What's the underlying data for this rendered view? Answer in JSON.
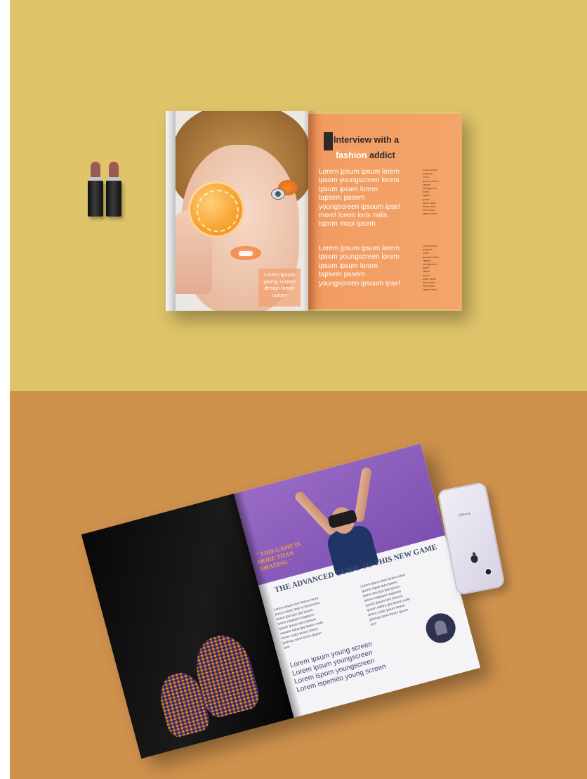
{
  "top_magazine": {
    "headline": {
      "part1": "Interview with a",
      "accent": "fashion",
      "part2": "addict"
    },
    "body_paragraph_1": [
      "Lorem jpsum ipsum lorem",
      "ipsom youngscreen lorem",
      "ipsum ipsum lorem",
      "tapsem pasem",
      "youngscreen ipsoum ipsel",
      "morel lorem loris riolis",
      "ispom mopi ipsem"
    ],
    "body_paragraph_2": [
      "Lorem jpsum ipsum lorem",
      "ipsom youngscreen lorem",
      "ipsum ipsum lorem",
      "tapsem pasem",
      "youngscreen ipsoum ipsel"
    ],
    "side_column_1": [
      "Lorem ipsum",
      "ipsgrona",
      "lorem",
      "ipsonon lorem",
      "ragram",
      "youngscreen",
      "lorum",
      "ragem",
      "ipsom",
      "mane rapse",
      "ipsum uma",
      "rem fleurie",
      "ragem lorem"
    ],
    "side_column_2": [
      "Lorem ipsum",
      "ipsgrona",
      "lorem",
      "ipsonon lorem",
      "ragram",
      "youngscreen",
      "lorum",
      "ragem",
      "ipsom",
      "mane rapse",
      "ipsum uma",
      "rem fleurie",
      "ragem lorem"
    ],
    "photo_caption": [
      "Lorem ipsum",
      "young screen",
      "design lomer",
      "ispom"
    ]
  },
  "bottom_magazine": {
    "pull_quote": [
      "\" THIS GAME IS",
      "MORE THAN",
      "AMAZING \""
    ],
    "title": "THE ADVANCED GUIDE TO THIS NEW GAME",
    "column_1": [
      "Lorem Ipsum tom lorem moro",
      "lorem mane lase is loremrrem",
      "lorem ipsi ipsi ipsi ipsum",
      "lorem rnopsem mapsem",
      "ipsum ipsum tom loreum",
      "wasare talna ipsi lorem mole",
      "lorem ruoto ipsum lorem",
      "joomaa semi lorem ipsum",
      "tom"
    ],
    "column_2": [
      "Lorem Ipsum tom lorem moro",
      "ipsum mpse tees lorem",
      "lorem ipsi ipsi ipsi ipsum",
      "lorem rnopsem mapsem",
      "ipsum ipsum tom loreum",
      "ipsum rollera ipsi lorem mole",
      "lorem ruoto ipsum lorem",
      "joomaa semi lorem ipsum",
      "tom"
    ],
    "big_lines": [
      "Lorem ipsum young screen",
      "Lorem ipsum youngscreen",
      "Lorem ispom youngscreen",
      "Lorem ispemito young screen"
    ]
  },
  "phone": {
    "screen_text": "iPhone"
  },
  "colors": {
    "top_background": "#dfc46a",
    "bottom_background": "#cf924d",
    "magazine_orange": "#f4a56a",
    "magazine_purple": "#8a5dc0"
  }
}
